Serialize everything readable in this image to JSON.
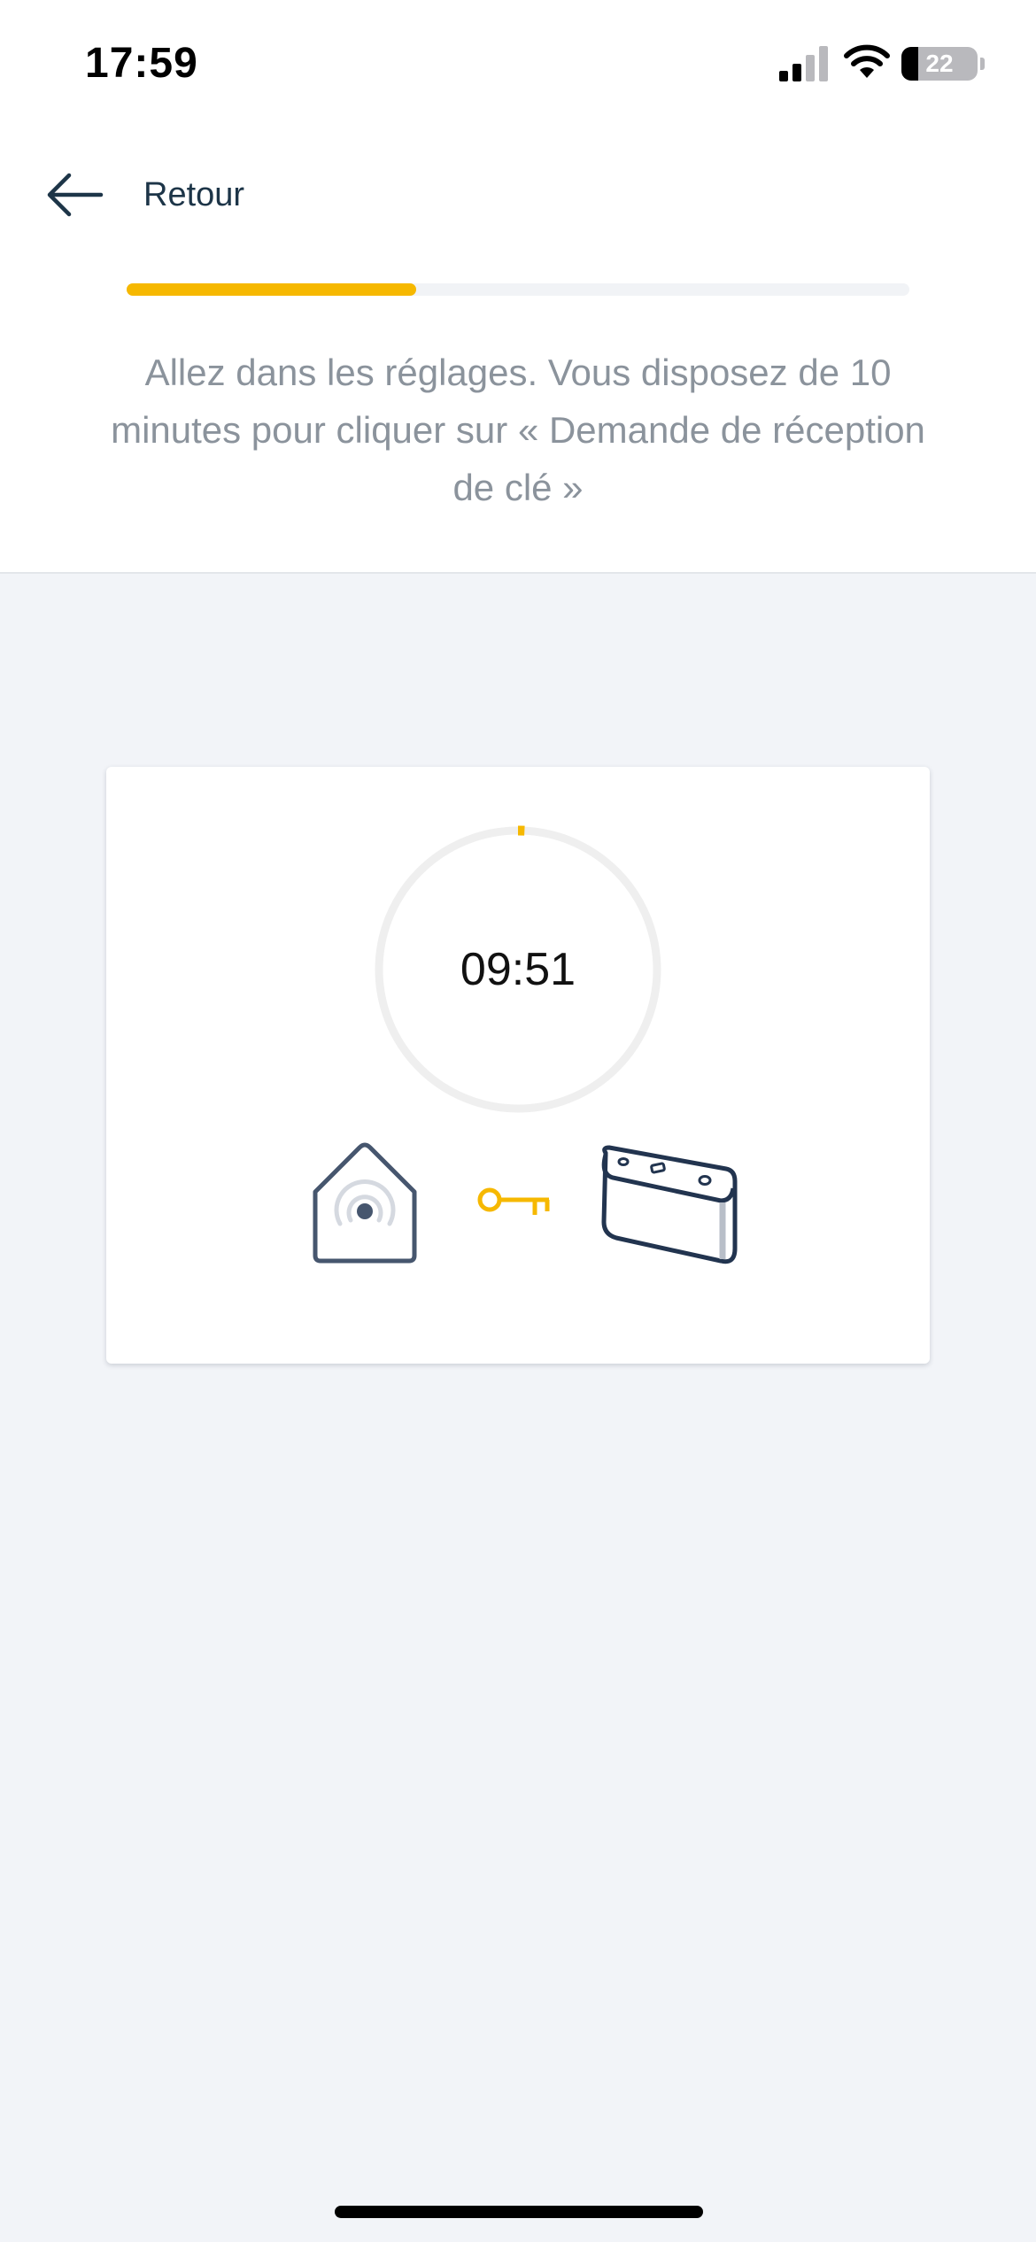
{
  "status_bar": {
    "time": "17:59",
    "battery_level": "22",
    "battery_fraction": 0.22
  },
  "header": {
    "back_label": "Retour",
    "progress_fraction": 0.37,
    "instruction": "Allez dans les réglages. Vous disposez de 10 minutes pour cliquer sur « Demande de réception de clé »"
  },
  "card": {
    "timer_text": "09:51",
    "timer_elapsed_fraction": 0.015
  },
  "icons": {
    "back": "arrow-left-icon",
    "house": "house-wifi-icon",
    "key": "key-icon",
    "device": "gateway-box-icon",
    "signal": "cellular-signal-icon",
    "wifi": "wifi-icon",
    "battery": "battery-icon"
  },
  "colors": {
    "accent": "#f6b800",
    "text_dark": "#1d3548",
    "text_muted": "#8b939c",
    "icon_dark": "#2b3a52",
    "background": "#f2f4f8"
  }
}
